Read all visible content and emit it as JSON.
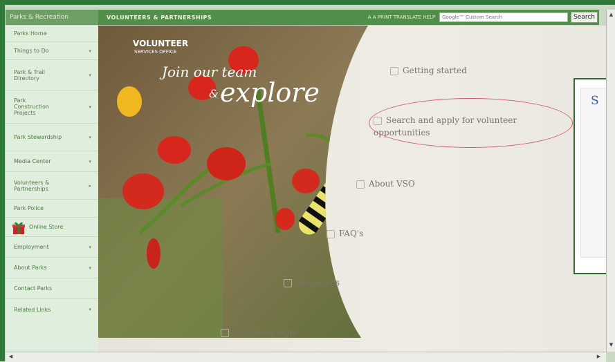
{
  "topbar": {
    "site_label": "Parks & Recreation",
    "section_title": "VOLUNTEERS & PARTNERSHIPS",
    "tools_text": "A  A  PRINT  TRANSLATE  HELP",
    "search_placeholder": "Google™ Custom Search",
    "search_button": "Search"
  },
  "sidebar": {
    "items": [
      {
        "label": "Parks Home",
        "expand": ""
      },
      {
        "label": "Things to Do",
        "expand": "▾"
      },
      {
        "label": "Park & Trail Directory",
        "expand": "▾"
      },
      {
        "label": "Park Construction Projects",
        "expand": "▾"
      },
      {
        "label": "Park Stewardship",
        "expand": "▾"
      },
      {
        "label": "Media Center",
        "expand": "▾"
      },
      {
        "label": "Volunteers & Partnerships",
        "expand": "▸"
      },
      {
        "label": "Park Police",
        "expand": ""
      },
      {
        "label": "Online Store",
        "expand": ""
      },
      {
        "label": "Employment",
        "expand": "▾"
      },
      {
        "label": "About Parks",
        "expand": "▾"
      },
      {
        "label": "Contact Parks",
        "expand": ""
      },
      {
        "label": "Related Links",
        "expand": "▾"
      }
    ]
  },
  "hero": {
    "logo_text": "VOLUNTEER",
    "logo_sub": "SERVICES OFFICE",
    "tagline_top": "Join our team",
    "tagline_amp": "&",
    "tagline_big": "explore"
  },
  "links": [
    "Getting started",
    "Search and apply for volunteer opportunities",
    "About VSO",
    "FAQ's",
    "Resources",
    "Volunteer login"
  ],
  "popup": {
    "letter": "S"
  },
  "colors": {
    "frame": "#2f7a3a",
    "highlight_oval": "#d45a6a",
    "link_text": "#7a7367"
  }
}
